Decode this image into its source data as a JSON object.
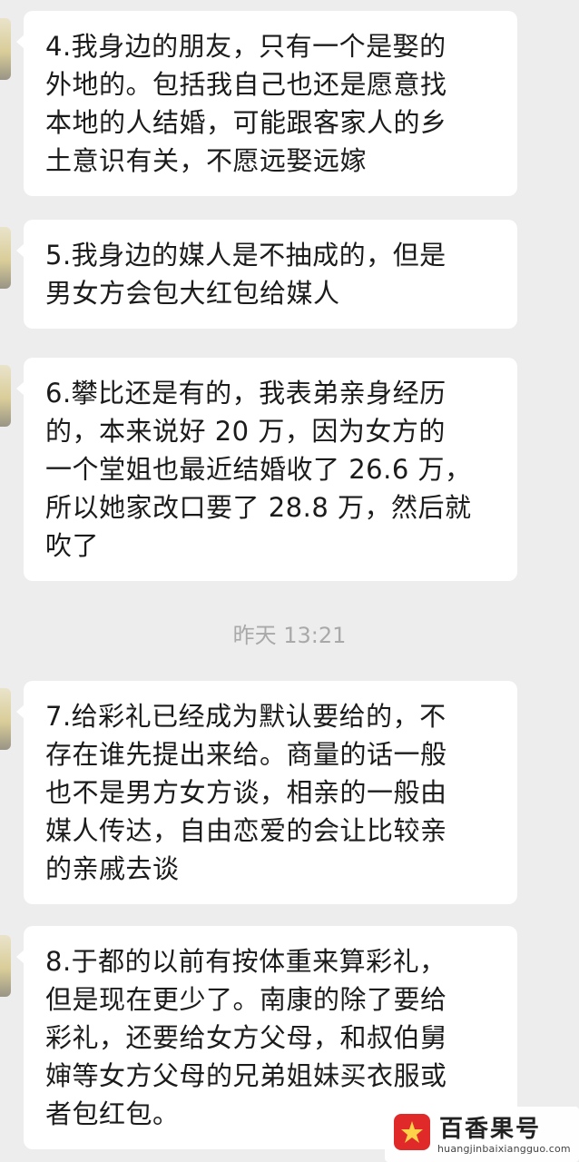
{
  "messages": [
    {
      "lines": [
        "4.我身边的朋友，只有一个是娶的",
        "外地的。包括我自己也还是愿意找",
        "本地的人结婚，可能跟客家人的乡",
        "土意识有关，不愿远娶远嫁"
      ]
    },
    {
      "lines": [
        "5.我身边的媒人是不抽成的，但是",
        "男女方会包大红包给媒人"
      ]
    },
    {
      "lines": [
        "6.攀比还是有的，我表弟亲身经历",
        "的，本来说好 20 万，因为女方的",
        "一个堂姐也最近结婚收了 26.6 万，",
        "所以她家改口要了 28.8 万，然后就",
        "吹了"
      ]
    },
    {
      "lines": [
        "7.给彩礼已经成为默认要给的，不",
        "存在谁先提出来给。商量的话一般",
        "也不是男方女方谈，相亲的一般由",
        "媒人传达，自由恋爱的会让比较亲",
        "的亲戚去谈"
      ]
    },
    {
      "lines": [
        "8.于都的以前有按体重来算彩礼，",
        "但是现在更少了。南康的除了要给",
        "彩礼，还要给女方父母，和叔伯舅",
        "婶等女方父母的兄弟姐妹买衣服或",
        "者包红包。"
      ]
    }
  ],
  "timestamp": "昨天 13:21",
  "watermark": {
    "name": "百香果号",
    "url": "huangjinbaixiangguo.com",
    "logo_color": "#e02a2a"
  },
  "colors": {
    "background": "#ededed",
    "bubble": "#ffffff",
    "text": "#1b1b1b",
    "timestamp": "#a9a9a9"
  }
}
